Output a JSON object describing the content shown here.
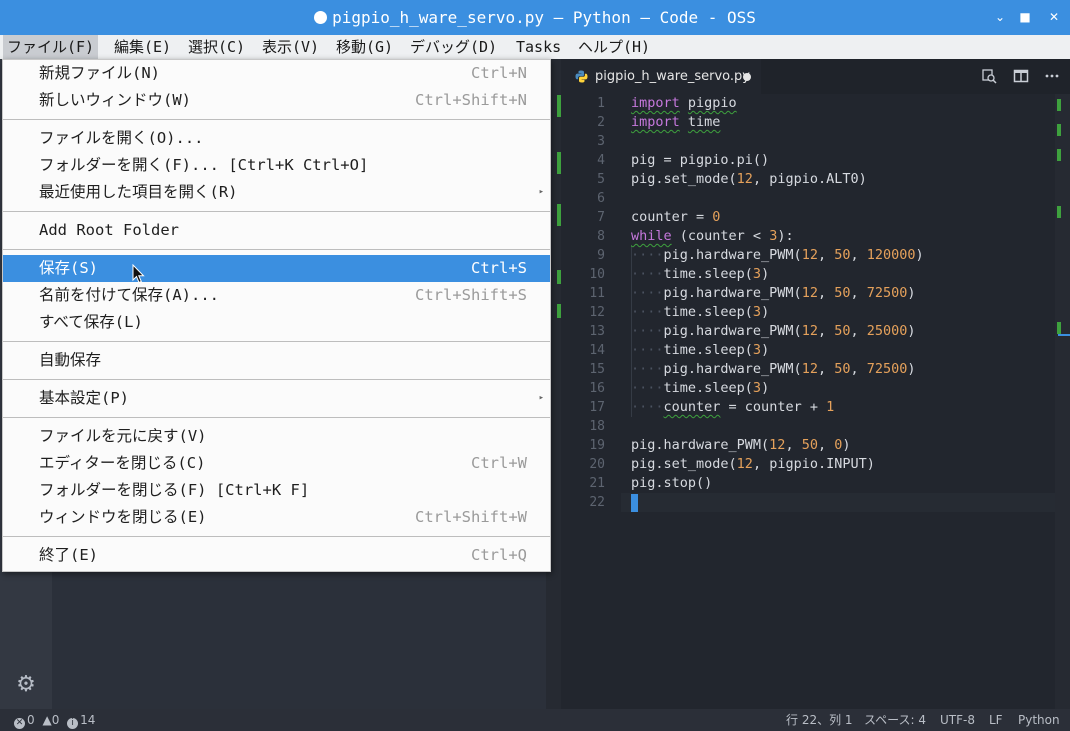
{
  "window": {
    "title": "pigpio_h_ware_servo.py — Python — Code - OSS",
    "buttons": [
      "⌄",
      "■",
      "✕"
    ]
  },
  "menubar": [
    "ファイル(F)",
    "編集(E)",
    "選択(C)",
    "表示(V)",
    "移動(G)",
    "デバッグ(D)",
    "Tasks",
    "ヘルプ(H)"
  ],
  "file_menu": {
    "items": [
      {
        "label": "新規ファイル(N)",
        "shortcut": "Ctrl+N"
      },
      {
        "label": "新しいウィンドウ(W)",
        "shortcut": "Ctrl+Shift+N"
      },
      {
        "label": "ファイルを開く(O)...",
        "shortcut": ""
      },
      {
        "label": "フォルダーを開く(F)... [Ctrl+K Ctrl+O]",
        "shortcut": ""
      },
      {
        "label": "最近使用した項目を開く(R)",
        "shortcut": "",
        "submenu": true
      },
      {
        "label": "Add Root Folder",
        "shortcut": ""
      },
      {
        "label": "保存(S)",
        "shortcut": "Ctrl+S",
        "highlighted": true
      },
      {
        "label": "名前を付けて保存(A)...",
        "shortcut": "Ctrl+Shift+S"
      },
      {
        "label": "すべて保存(L)",
        "shortcut": ""
      },
      {
        "label": "自動保存",
        "shortcut": ""
      },
      {
        "label": "基本設定(P)",
        "shortcut": "",
        "submenu": true
      },
      {
        "label": "ファイルを元に戻す(V)",
        "shortcut": ""
      },
      {
        "label": "エディターを閉じる(C)",
        "shortcut": "Ctrl+W"
      },
      {
        "label": "フォルダーを閉じる(F) [Ctrl+K F]",
        "shortcut": ""
      },
      {
        "label": "ウィンドウを閉じる(E)",
        "shortcut": "Ctrl+Shift+W"
      },
      {
        "label": "終了(E)",
        "shortcut": "Ctrl+Q"
      }
    ],
    "submenu_arrow": "▸"
  },
  "tab": {
    "filename": "pigpio_h_ware_servo.py",
    "dirty": true
  },
  "toolbar_icons": [
    "open-changes-icon",
    "split-editor-icon",
    "more-icon"
  ],
  "editor": {
    "line_numbers": [
      "1",
      "2",
      "3",
      "4",
      "5",
      "6",
      "7",
      "8",
      "9",
      "10",
      "11",
      "12",
      "13",
      "14",
      "15",
      "16",
      "17",
      "18",
      "19",
      "20",
      "21",
      "22"
    ],
    "code_lines": [
      "import pigpio",
      "import time",
      "",
      "pig = pigpio.pi()",
      "pig.set_mode(12, pigpio.ALT0)",
      "",
      "counter = 0",
      "while (counter < 3):",
      "    pig.hardware_PWM(12, 50, 120000)",
      "    time.sleep(3)",
      "    pig.hardware_PWM(12, 50, 72500)",
      "    time.sleep(3)",
      "    pig.hardware_PWM(12, 50, 25000)",
      "    time.sleep(3)",
      "    pig.hardware_PWM(12, 50, 72500)",
      "    time.sleep(3)",
      "    counter = counter + 1",
      "",
      "pig.hardware_PWM(12, 50, 0)",
      "pig.set_mode(12, pigpio.INPUT)",
      "pig.stop()",
      ""
    ],
    "cursor_line": 22
  },
  "statusbar": {
    "errors": "0",
    "warnings": "0",
    "info": "14",
    "position": "行 22、列 1",
    "spaces": "スペース: 4",
    "encoding": "UTF-8",
    "eol": "LF",
    "language": "Python"
  },
  "colors": {
    "accent": "#3b8fe0",
    "keyword": "#c678dd",
    "number": "#e5a15b",
    "git_added": "#3ea13e"
  }
}
